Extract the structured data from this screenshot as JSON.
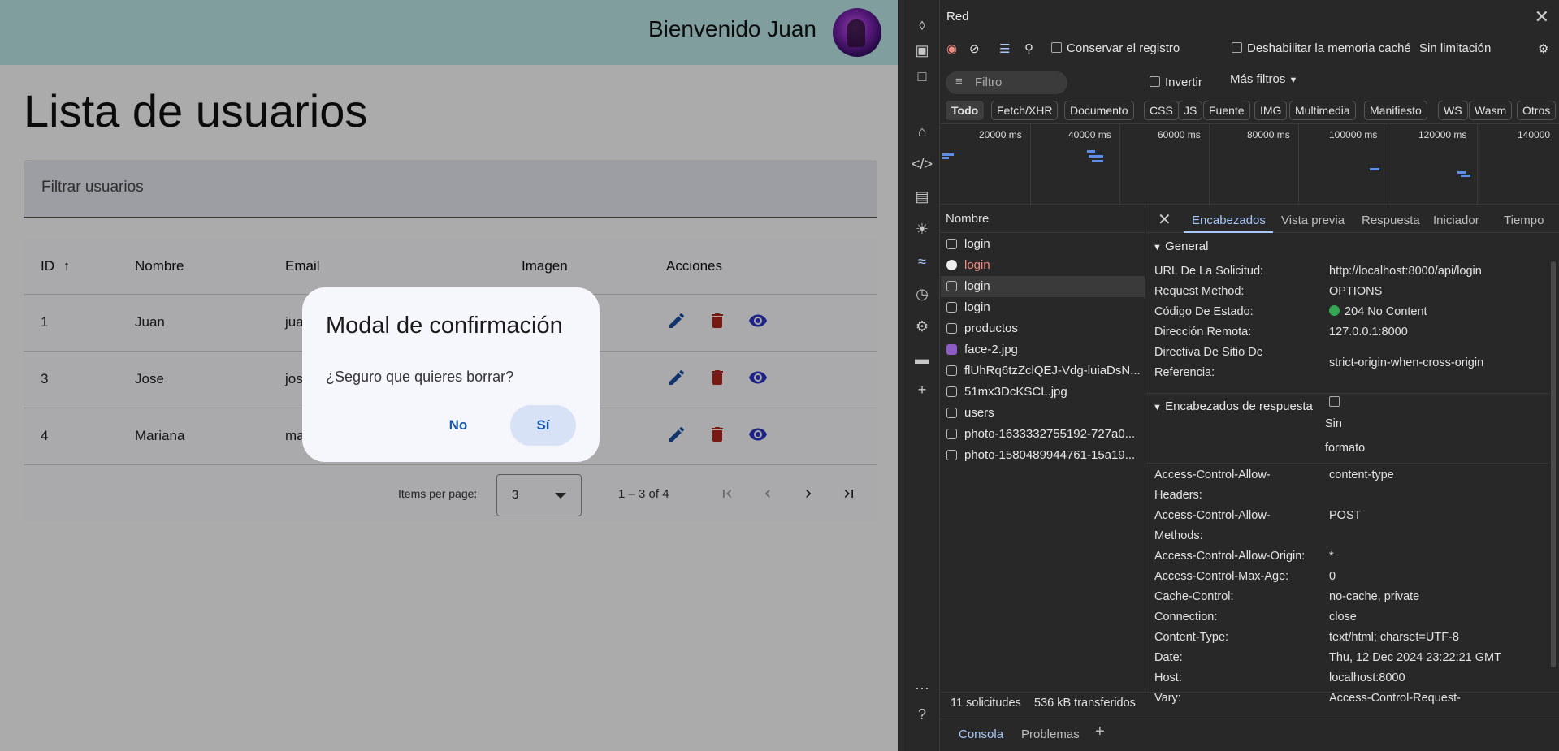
{
  "app": {
    "welcome": "Bienvenido Juan",
    "title": "Lista de usuarios",
    "filter_placeholder": "Filtrar usuarios",
    "table": {
      "columns": [
        "ID",
        "Nombre",
        "Email",
        "Imagen",
        "Acciones"
      ],
      "sort_icon": "arrow-up-icon",
      "rows": [
        {
          "id": "1",
          "nombre": "Juan",
          "email": "jua"
        },
        {
          "id": "3",
          "nombre": "Jose",
          "email": "jos"
        },
        {
          "id": "4",
          "nombre": "Mariana",
          "email": "ma"
        }
      ],
      "action_icons": [
        "edit-icon",
        "delete-icon",
        "view-icon"
      ],
      "action_colors": {
        "edit": "#1a4fa0",
        "delete": "#b3261e",
        "view": "#2d35c6"
      }
    },
    "paginator": {
      "items_per_page_label": "Items per page:",
      "items_per_page_value": "3",
      "range_label": "1 – 3 of 4"
    },
    "modal": {
      "title": "Modal de confirmación",
      "text": "¿Seguro que quieres borrar?",
      "no_label": "No",
      "yes_label": "Sí"
    }
  },
  "devtools": {
    "title": "Red",
    "toolbar": {
      "preserve_log": "Conservar el registro",
      "disable_cache": "Deshabilitar la memoria caché",
      "throttling": "Sin limitación"
    },
    "filter_placeholder": "Filtro",
    "invert_label": "Invertir",
    "more_filters": "Más filtros",
    "type_filters": [
      "Todo",
      "Fetch/XHR",
      "Documento",
      "CSS",
      "JS",
      "Fuente",
      "IMG",
      "Multimedia",
      "Manifiesto",
      "WS",
      "Wasm",
      "Otros"
    ],
    "timeline_ticks": [
      "20000  ms",
      "40000  ms",
      "60000  ms",
      "80000  ms",
      "100000  ms",
      "120000  ms",
      "140000"
    ],
    "name_header": "Nombre",
    "requests": [
      "login",
      "login",
      "login",
      "login",
      "productos",
      "face-2.jpg",
      "flUhRq6tzZclQEJ-Vdg-luiaDsN...",
      "51mx3DcKSCL.jpg",
      "users",
      "photo-1633332755192-727a0...",
      "photo-1580489944761-15a19..."
    ],
    "detail_tabs": [
      "Encabezados",
      "Vista previa",
      "Respuesta",
      "Iniciador",
      "Tiempo"
    ],
    "general_title": "General",
    "general": [
      {
        "k": "URL De La Solicitud:",
        "v": "http://localhost:8000/api/login"
      },
      {
        "k": "Request Method:",
        "v": "OPTIONS"
      },
      {
        "k": "Código De Estado:",
        "v": "204 No Content"
      },
      {
        "k": "Dirección Remota:",
        "v": "127.0.0.1:8000"
      },
      {
        "k": "Directiva De Sitio De",
        "v": ""
      },
      {
        "k": "Referencia:",
        "v": "strict-origin-when-cross-origin"
      }
    ],
    "response_title": "Encabezados de respuesta",
    "raw_label_1": "Sin",
    "raw_label_2": "formato",
    "response_headers": [
      {
        "k": "Access-Control-Allow-",
        "v": "content-type"
      },
      {
        "k": "Headers:",
        "v": ""
      },
      {
        "k": "Access-Control-Allow-",
        "v": "POST"
      },
      {
        "k": "Methods:",
        "v": ""
      },
      {
        "k": "Access-Control-Allow-Origin:",
        "v": "*"
      },
      {
        "k": "Access-Control-Max-Age:",
        "v": "0"
      },
      {
        "k": "Cache-Control:",
        "v": "no-cache, private"
      },
      {
        "k": "Connection:",
        "v": "close"
      },
      {
        "k": "Content-Type:",
        "v": "text/html; charset=UTF-8"
      },
      {
        "k": "Date:",
        "v": "Thu, 12 Dec 2024 23:22:21 GMT"
      },
      {
        "k": "Host:",
        "v": "localhost:8000"
      },
      {
        "k": "Vary:",
        "v": "Access-Control-Request-"
      }
    ],
    "footer": {
      "requests": "11 solicitudes",
      "transferred": "536 kB transferidos"
    },
    "bottom_tabs": [
      "Consola",
      "Problemas"
    ]
  }
}
